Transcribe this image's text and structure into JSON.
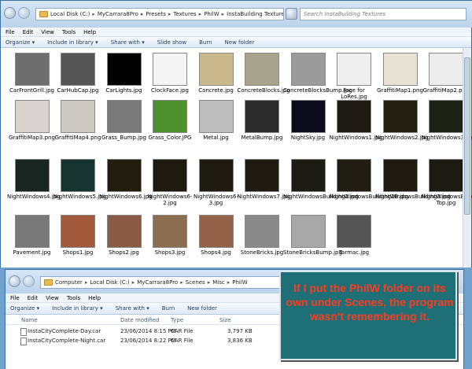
{
  "window1": {
    "breadcrumb": [
      "Local Disk (C:)",
      "MyCarrara8Pro",
      "Presets",
      "Textures",
      "PhilW",
      "InstaBuilding Textures"
    ],
    "search_placeholder": "Search InstaBuilding Textures",
    "menu": [
      "File",
      "Edit",
      "View",
      "Tools",
      "Help"
    ],
    "commands": [
      "Organize ▾",
      "Include in library ▾",
      "Share with ▾",
      "Slide show",
      "Burn",
      "New folder"
    ],
    "files": [
      {
        "name": "CarFrontGrill.jpg",
        "color": "#6e6e6e"
      },
      {
        "name": "CarHubCap.jpg",
        "color": "#555555"
      },
      {
        "name": "CarLights.jpg",
        "color": "#000000"
      },
      {
        "name": "ClockFace.jpg",
        "color": "#f4f4f4"
      },
      {
        "name": "Concrete.jpg",
        "color": "#c9b98c"
      },
      {
        "name": "ConcreteBlocks.jpg",
        "color": "#a8a48c"
      },
      {
        "name": "ConcreteBlocksBump.jpg",
        "color": "#9b9b9b"
      },
      {
        "name": "Face for LoRes.jpg",
        "color": "#efefef"
      },
      {
        "name": "GraffitiMap1.png",
        "color": "#e7e1d6"
      },
      {
        "name": "GraffitiMap2.png",
        "color": "#ededed"
      },
      {
        "name": "GraffitiMap3.png",
        "color": "#d9d3cf"
      },
      {
        "name": "GraffitiMap4.png",
        "color": "#cfc9c4"
      },
      {
        "name": "Grass_Bump.jpg",
        "color": "#7a7a7a"
      },
      {
        "name": "Grass_Color.JPG",
        "color": "#4e8f2e"
      },
      {
        "name": "Metal.jpg",
        "color": "#bdbdbd"
      },
      {
        "name": "MetalBump.jpg",
        "color": "#2a2a2a"
      },
      {
        "name": "NightSky.jpg",
        "color": "#0a0c1c"
      },
      {
        "name": "NightWindows1.jpg",
        "color": "#1c1a12"
      },
      {
        "name": "NightWindows2.jpg",
        "color": "#221e10"
      },
      {
        "name": "NightWindows3.jpg",
        "color": "#1d2216"
      },
      {
        "name": "NightWindows4.jpg",
        "color": "#1a2420"
      },
      {
        "name": "NightWindows5.jpg",
        "color": "#173330"
      },
      {
        "name": "NightWindows6.jpg",
        "color": "#231d10"
      },
      {
        "name": "NightWindows6-2.jpg",
        "color": "#1f1a10"
      },
      {
        "name": "NightWindows6-3.jpg",
        "color": "#201b10"
      },
      {
        "name": "NightWindows7.jpg",
        "color": "#1e1c12"
      },
      {
        "name": "NightWindowsBuilding2.jpg",
        "color": "#1c1c14"
      },
      {
        "name": "NightWindowsBuilding2B.jpg",
        "color": "#221d12"
      },
      {
        "name": "NightWindowsBuilding3.jpg",
        "color": "#1f1b12"
      },
      {
        "name": "NightWindowsBuilding3-Top.jpg",
        "color": "#1b1b14"
      },
      {
        "name": "Pavement.jpg",
        "color": "#787878"
      },
      {
        "name": "Shops1.jpg",
        "color": "#a35a3c"
      },
      {
        "name": "Shops2.jpg",
        "color": "#8a5a44"
      },
      {
        "name": "Shops3.jpg",
        "color": "#8b6d50"
      },
      {
        "name": "Shops4.jpg",
        "color": "#946248"
      },
      {
        "name": "StoneBricks.jpg",
        "color": "#8a8a8a"
      },
      {
        "name": "StoneBricksBump.jpg",
        "color": "#a8a8a8"
      },
      {
        "name": "Tarmac.jpg",
        "color": "#555555"
      }
    ]
  },
  "window2": {
    "breadcrumb": [
      "Computer",
      "Local Disk (C:)",
      "MyCarrara8Pro",
      "Scenes",
      "Misc",
      "PhilW"
    ],
    "menu": [
      "File",
      "Edit",
      "View",
      "Tools",
      "Help"
    ],
    "commands": [
      "Organize ▾",
      "Include in library ▾",
      "Share with ▾",
      "Burn",
      "New folder"
    ],
    "columns": [
      "Name",
      "Date modified",
      "Type",
      "Size"
    ],
    "rows": [
      {
        "name": "InstaCityComplete-Day.car",
        "date": "23/06/2014 8:15 PM",
        "type": "CAR File",
        "size": "3,797 KB"
      },
      {
        "name": "InstaCityComplete-Night.car",
        "date": "23/06/2014 8:22 PM",
        "type": "CAR File",
        "size": "3,836 KB"
      }
    ]
  },
  "callout": "If I put the PhilW folder on its own under Scenes, the program wasn't remembering it."
}
